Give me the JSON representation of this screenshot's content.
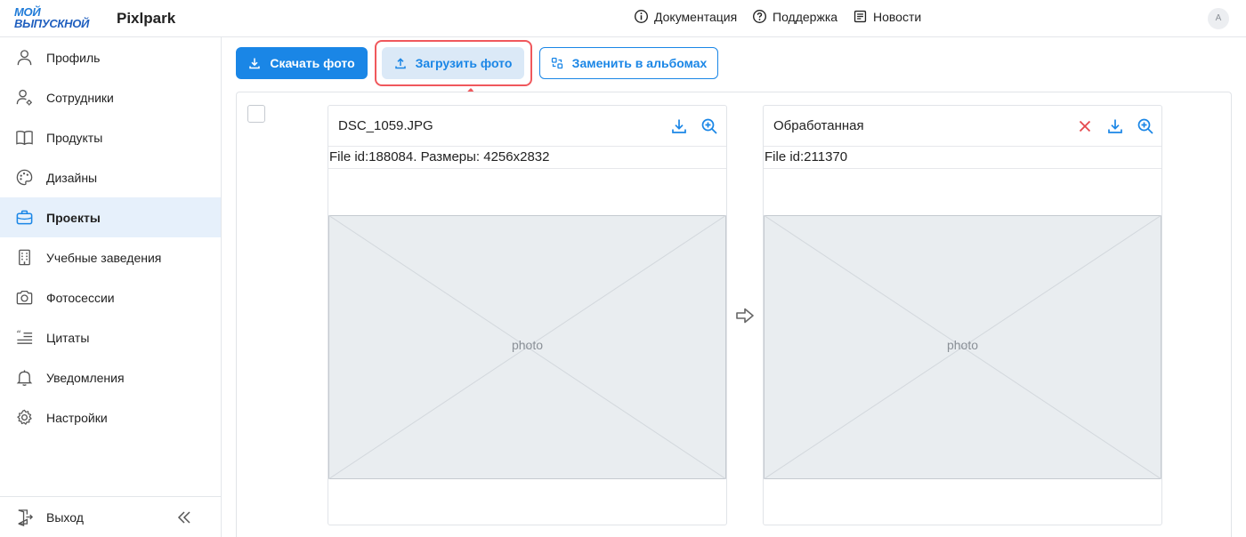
{
  "header": {
    "logo_line1": "МОЙ",
    "logo_line2": "ВЫПУСКНОЙ",
    "brand": "Pixlpark",
    "nav": [
      {
        "label": "Документация",
        "icon": "info-icon"
      },
      {
        "label": "Поддержка",
        "icon": "help-icon"
      },
      {
        "label": "Новости",
        "icon": "news-icon"
      }
    ],
    "avatar": "A"
  },
  "sidebar": {
    "items": [
      {
        "label": "Профиль",
        "icon": "user-icon"
      },
      {
        "label": "Сотрудники",
        "icon": "user-gear-icon"
      },
      {
        "label": "Продукты",
        "icon": "book-icon"
      },
      {
        "label": "Дизайны",
        "icon": "palette-icon"
      },
      {
        "label": "Проекты",
        "icon": "briefcase-icon",
        "active": true
      },
      {
        "label": "Учебные заведения",
        "icon": "building-icon"
      },
      {
        "label": "Фотосессии",
        "icon": "camera-icon"
      },
      {
        "label": "Цитаты",
        "icon": "quote-icon"
      },
      {
        "label": "Уведомления",
        "icon": "bell-icon"
      },
      {
        "label": "Настройки",
        "icon": "gear-icon"
      }
    ],
    "logout": "Выход"
  },
  "toolbar": {
    "download_label": "Скачать фото",
    "upload_label": "Загрузить фото",
    "replace_label": "Заменить в альбомах"
  },
  "original_card": {
    "title": "DSC_1059.JPG",
    "info": "File id:188084. Размеры: 4256x2832"
  },
  "processed_card": {
    "title": "Обработанная",
    "info": "File id:211370"
  },
  "colors": {
    "accent": "#1a86e6",
    "active_bg": "#e6f0fb",
    "highlight": "#f0585c"
  }
}
